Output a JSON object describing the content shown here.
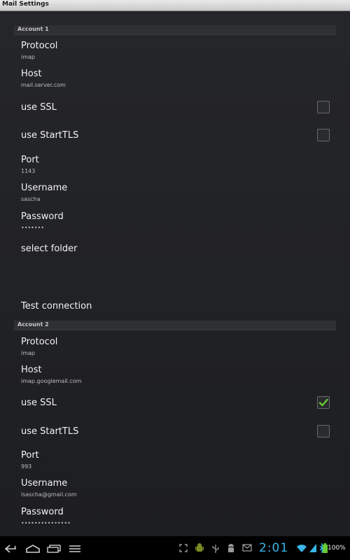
{
  "window": {
    "title": "Mail Settings"
  },
  "accounts": [
    {
      "header": "Account 1",
      "protocol_title": "Protocol",
      "protocol_value": "imap",
      "host_title": "Host",
      "host_value": "mail.server.com",
      "ssl_title": "use SSL",
      "ssl_checked": false,
      "starttls_title": "use StartTLS",
      "starttls_checked": false,
      "port_title": "Port",
      "port_value": "1143",
      "username_title": "Username",
      "username_value": "sascha",
      "password_title": "Password",
      "password_value": "•••••••",
      "folder_title": "select folder",
      "test_title": "Test connection"
    },
    {
      "header": "Account 2",
      "protocol_title": "Protocol",
      "protocol_value": "imap",
      "host_title": "Host",
      "host_value": "imap.googlemail.com",
      "ssl_title": "use SSL",
      "ssl_checked": true,
      "starttls_title": "use StartTLS",
      "starttls_checked": false,
      "port_title": "Port",
      "port_value": "993",
      "username_title": "Username",
      "username_value": "lsascha@gmail.com",
      "password_title": "Password",
      "password_value": "•••••••••••••••"
    }
  ],
  "statusbar": {
    "time": "2:01",
    "battery": "100%",
    "icons": [
      "back-icon",
      "home-icon",
      "recent-apps-icon",
      "menu-icon",
      "fullscreen-icon",
      "android-debug-icon",
      "usb-icon",
      "android-icon",
      "mail-icon",
      "wifi-icon",
      "signal-icon",
      "bluetooth-icon",
      "battery-icon"
    ]
  },
  "colors": {
    "accent": "#38b6e8",
    "check": "#66cc33",
    "background": "#222327"
  }
}
